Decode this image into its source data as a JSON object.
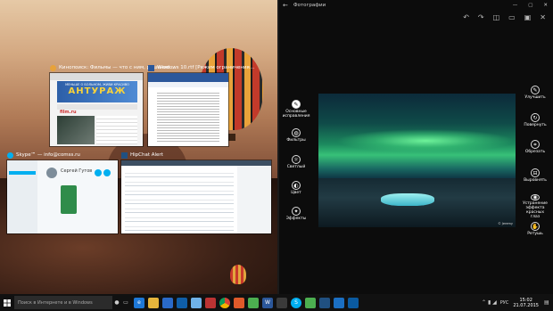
{
  "windows": {
    "film": {
      "title": "Кинопоиск: Фильмы — что с ним, решение…",
      "banner": "АНТУРАЖ",
      "banner_top": "МЕНЬШЕ О БОЛЬНОМ, ЖИВИ КРАСИВО",
      "site": "film.ru"
    },
    "word": {
      "title": "Windows 10.rtf [Режим ограничения…"
    },
    "skype": {
      "title": "Skype™ — info@comss.ru",
      "contact": "Сергей Гутов"
    },
    "hipchat": {
      "title": "HipChat Alert"
    }
  },
  "photos": {
    "app_title": "Фотографии",
    "left_tools": [
      {
        "label": "Основные исправления",
        "icon": "wand-icon"
      },
      {
        "label": "Фильтры",
        "icon": "filter-icon"
      },
      {
        "label": "Светлый",
        "icon": "sun-icon"
      },
      {
        "label": "Цвет",
        "icon": "color-icon"
      },
      {
        "label": "Эффекты",
        "icon": "effects-icon"
      }
    ],
    "right_tools": [
      {
        "label": "Улучшить",
        "icon": "enhance-icon"
      },
      {
        "label": "Повернуть",
        "icon": "rotate-icon"
      },
      {
        "label": "Обрезать",
        "icon": "crop-icon"
      },
      {
        "label": "Выровнять",
        "icon": "straighten-icon"
      },
      {
        "label": "Устранение эффекта красных глаз",
        "icon": "redeye-icon"
      },
      {
        "label": "Ретушь",
        "icon": "retouch-icon"
      }
    ],
    "image_credit": "© Jeremy"
  },
  "taskbar": {
    "search_placeholder": "Поиск в Интернете и в Windows",
    "lang": "РУС",
    "time": "15:02",
    "date": "21.07.2015"
  }
}
